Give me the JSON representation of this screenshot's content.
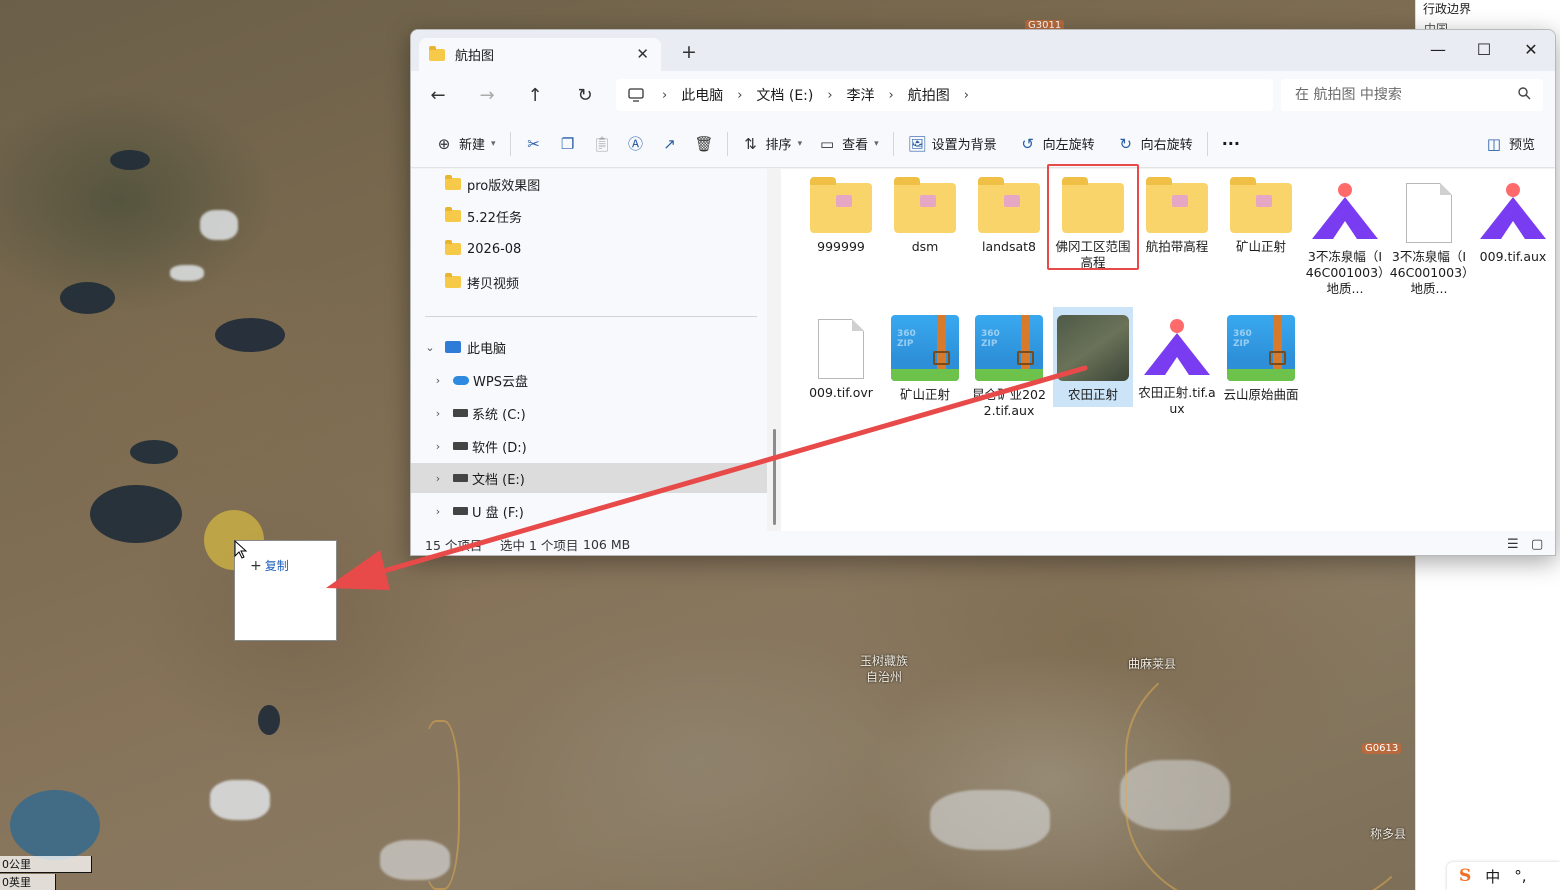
{
  "map": {
    "labels": {
      "yushu": "玉树藏族\n自治州",
      "qumalai": "曲麻莱县",
      "right_town": "称多县"
    },
    "road_shields": [
      "G3011",
      "G0613"
    ],
    "scale_km": "0公里",
    "scale_mi": "0英里"
  },
  "right_panel": {
    "title": "行政边界",
    "sub": "中国"
  },
  "ime": {
    "logo": "S",
    "mode": "中",
    "punct": "°,"
  },
  "drag": {
    "tip": "复制",
    "tip_icon": "+"
  },
  "window": {
    "tab_title": "航拍图",
    "tab_close": "✕",
    "new_tab": "+",
    "minimize": "—",
    "maximize": "☐",
    "close": "✕"
  },
  "nav": {
    "back": "←",
    "forward": "→",
    "up": "↑",
    "refresh": "↻",
    "breadcrumb": [
      "此电脑",
      "文档 (E:)",
      "李洋",
      "航拍图"
    ],
    "search_placeholder": "在 航拍图 中搜索"
  },
  "toolbar": {
    "new": "新建",
    "sort": "排序",
    "view": "查看",
    "set_background": "设置为背景",
    "rotate_left": "向左旋转",
    "rotate_right": "向右旋转",
    "more": "···",
    "preview": "预览"
  },
  "nav_pane": {
    "quick_items": [
      "pro版效果图",
      "5.22任务",
      "2026-08",
      "拷贝视频"
    ],
    "this_pc": "此电脑",
    "drives": [
      {
        "label": "WPS云盘",
        "icon": "cloud-icon"
      },
      {
        "label": "系统 (C:)",
        "icon": "drive-icon"
      },
      {
        "label": "软件 (D:)",
        "icon": "drive-icon"
      },
      {
        "label": "文档 (E:)",
        "icon": "drive-icon",
        "selected": true
      },
      {
        "label": "U 盘 (F:)",
        "icon": "drive-icon"
      }
    ]
  },
  "files": [
    {
      "name": "999999",
      "icon": "folder-image-icon"
    },
    {
      "name": "dsm",
      "icon": "folder-image-icon"
    },
    {
      "name": "landsat8",
      "icon": "folder-image-icon"
    },
    {
      "name": "佛冈工区范围高程",
      "icon": "folder-icon"
    },
    {
      "name": "航拍带高程",
      "icon": "folder-image-icon"
    },
    {
      "name": "矿山正射",
      "icon": "folder-image-icon"
    },
    {
      "name": "3不冻泉幅（I46C001003）地质...",
      "icon": "app-logo-icon"
    },
    {
      "name": "3不冻泉幅（I46C001003）地质...",
      "icon": "document-icon"
    },
    {
      "name": "009.tif.aux",
      "icon": "app-logo-icon"
    },
    {
      "name": "009.tif.ovr",
      "icon": "document-icon"
    },
    {
      "name": "矿山正射",
      "icon": "zip-archive-icon"
    },
    {
      "name": "昆仑矿业2022.tif.aux",
      "icon": "zip-archive-icon"
    },
    {
      "name": "农田正射",
      "icon": "image-thumbnail-icon",
      "selected": true
    },
    {
      "name": "农田正射.tif.aux",
      "icon": "app-logo-icon"
    },
    {
      "name": "云山原始曲面",
      "icon": "zip-archive-icon"
    }
  ],
  "status": {
    "count": "15 个项目",
    "selected": "选中 1 个项目",
    "size": "106 MB"
  },
  "colors": {
    "annotation_red": "#e84a4a",
    "selection_blue": "#cce4f7",
    "folder_yellow": "#f9d46a"
  }
}
